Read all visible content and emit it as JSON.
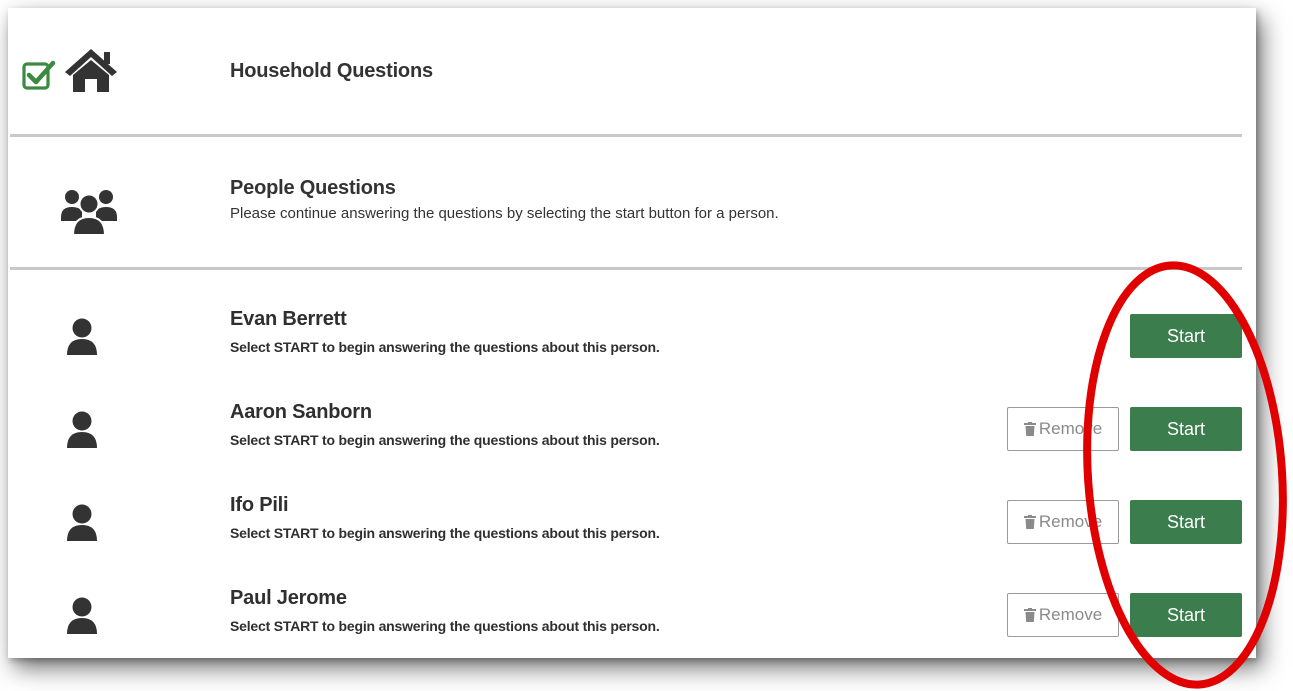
{
  "household": {
    "title": "Household Questions",
    "check_icon": "check-square-icon",
    "house_icon": "house-icon",
    "accent_color": "#3a8a3f"
  },
  "people_section": {
    "title": "People Questions",
    "subtitle": "Please continue answering the questions by selecting the start button for a person.",
    "icon": "users-icon"
  },
  "persons": [
    {
      "name": "Evan Berrett",
      "desc": "Select START to begin answering the questions about this person.",
      "start_label": "Start",
      "remove_label": ""
    },
    {
      "name": "Aaron Sanborn",
      "desc": "Select START to begin answering the questions about this person.",
      "start_label": "Start",
      "remove_label": "Remove"
    },
    {
      "name": "Ifo Pili",
      "desc": "Select START to begin answering the questions about this person.",
      "start_label": "Start",
      "remove_label": "Remove"
    },
    {
      "name": "Paul Jerome",
      "desc": "Select START to begin answering the questions about this person.",
      "start_label": "Start",
      "remove_label": "Remove"
    }
  ],
  "colors": {
    "start_button": "#3b7d4c",
    "annotation": "#e00000",
    "divider": "#c8c8c8"
  }
}
